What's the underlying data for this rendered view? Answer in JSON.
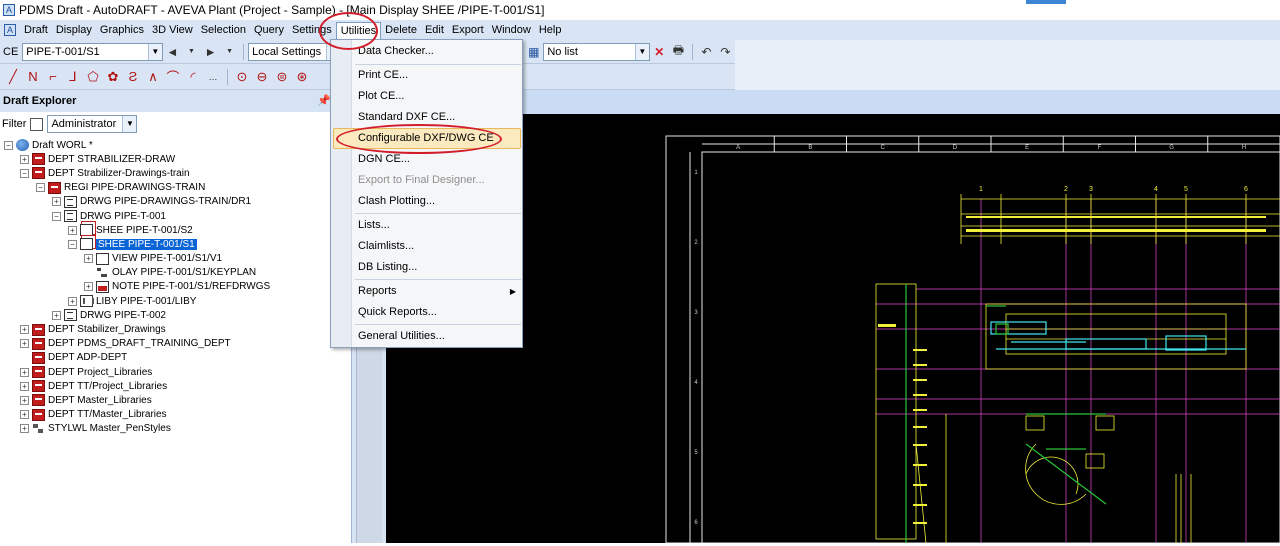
{
  "window": {
    "title": "PDMS Draft - AutoDRAFT -  AVEVA Plant (Project - Sample) - [Main Display  SHEE  /PIPE-T-001/S1]",
    "app_icon_glyph": "A"
  },
  "menubar": {
    "items": [
      "Draft",
      "Display",
      "Graphics",
      "3D View",
      "Selection",
      "Query",
      "Settings",
      "Utilities",
      "Delete",
      "Edit",
      "Export",
      "Window",
      "Help"
    ],
    "active": "Utilities"
  },
  "toolbar1": {
    "ce_label": "CE",
    "ce_value": "PIPE-T-001/S1",
    "settings_value": "Local Settings",
    "list_value": "No list"
  },
  "explorer": {
    "title": "Draft Explorer",
    "pin_glyph": "📌",
    "filter_label": "Filter",
    "filter_value": "Administrator",
    "tree": [
      {
        "label": "Draft WORL *",
        "depth": 0,
        "icon": "globe",
        "exp": "-"
      },
      {
        "label": "DEPT STRABILIZER-DRAW",
        "depth": 1,
        "icon": "dept",
        "exp": "+"
      },
      {
        "label": "DEPT Strabilizer-Drawings-train",
        "depth": 1,
        "icon": "dept",
        "exp": "-"
      },
      {
        "label": "REGI PIPE-DRAWINGS-TRAIN",
        "depth": 2,
        "icon": "dept",
        "exp": "-"
      },
      {
        "label": "DRWG PIPE-DRAWINGS-TRAIN/DR1",
        "depth": 3,
        "icon": "drwg",
        "exp": "+"
      },
      {
        "label": "DRWG PIPE-T-001",
        "depth": 3,
        "icon": "drwg",
        "exp": "-"
      },
      {
        "label": "SHEE PIPE-T-001/S2",
        "depth": 4,
        "icon": "shee",
        "exp": "+"
      },
      {
        "label": "SHEE PIPE-T-001/S1",
        "depth": 4,
        "icon": "shee",
        "exp": "-",
        "selected": true
      },
      {
        "label": "VIEW PIPE-T-001/S1/V1",
        "depth": 5,
        "icon": "view",
        "exp": "+"
      },
      {
        "label": "OLAY PIPE-T-001/S1/KEYPLAN",
        "depth": 5,
        "icon": "olay",
        "exp": ""
      },
      {
        "label": "NOTE PIPE-T-001/S1/REFDRWGS",
        "depth": 5,
        "icon": "note",
        "exp": "+"
      },
      {
        "label": "LIBY PIPE-T-001/LIBY",
        "depth": 4,
        "icon": "liby",
        "exp": "+"
      },
      {
        "label": "DRWG PIPE-T-002",
        "depth": 3,
        "icon": "drwg",
        "exp": "+"
      },
      {
        "label": "DEPT Stabilizer_Drawings",
        "depth": 1,
        "icon": "dept",
        "exp": "+"
      },
      {
        "label": "DEPT PDMS_DRAFT_TRAINING_DEPT",
        "depth": 1,
        "icon": "dept",
        "exp": "+"
      },
      {
        "label": "DEPT ADP-DEPT",
        "depth": 1,
        "icon": "dept",
        "exp": ""
      },
      {
        "label": "DEPT Project_Libraries",
        "depth": 1,
        "icon": "dept",
        "exp": "+"
      },
      {
        "label": "DEPT TT/Project_Libraries",
        "depth": 1,
        "icon": "dept",
        "exp": "+"
      },
      {
        "label": "DEPT Master_Libraries",
        "depth": 1,
        "icon": "dept",
        "exp": "+"
      },
      {
        "label": "DEPT TT/Master_Libraries",
        "depth": 1,
        "icon": "dept",
        "exp": "+"
      },
      {
        "label": "STYLWL Master_PenStyles",
        "depth": 1,
        "icon": "styl",
        "exp": "+"
      }
    ]
  },
  "utilities_menu": {
    "items": [
      {
        "label": "Data Checker...",
        "disabled": false
      },
      {
        "label": "Print CE...",
        "disabled": false
      },
      {
        "label": "Plot CE...",
        "disabled": false
      },
      {
        "label": "Standard DXF CE...",
        "disabled": false
      },
      {
        "label": "Configurable DXF/DWG CE",
        "disabled": false,
        "highlighted": true
      },
      {
        "label": "DGN  CE...",
        "disabled": false
      },
      {
        "label": "Export to Final Designer...",
        "disabled": true
      },
      {
        "label": "Clash Plotting...",
        "disabled": false
      },
      {
        "label": "Lists...",
        "disabled": false
      },
      {
        "label": "Claimlists...",
        "disabled": false
      },
      {
        "label": "DB Listing...",
        "disabled": false
      },
      {
        "label": "Reports",
        "disabled": false,
        "submenu": true
      },
      {
        "label": "Quick Reports...",
        "disabled": false
      },
      {
        "label": "General Utilities...",
        "disabled": false
      }
    ]
  },
  "drawing": {
    "col_labels": [
      "A",
      "B",
      "C",
      "D",
      "E",
      "F",
      "G",
      "H"
    ],
    "row_labels": [
      "1",
      "2",
      "3",
      "4",
      "5",
      "6"
    ],
    "grid_numbers": [
      "1",
      "2",
      "3",
      "4",
      "5",
      "6"
    ]
  },
  "colors": {
    "annotation_red": "#d21e2b",
    "menu_highlight": "#fbe9bf",
    "selection_blue": "#0a64d6"
  }
}
